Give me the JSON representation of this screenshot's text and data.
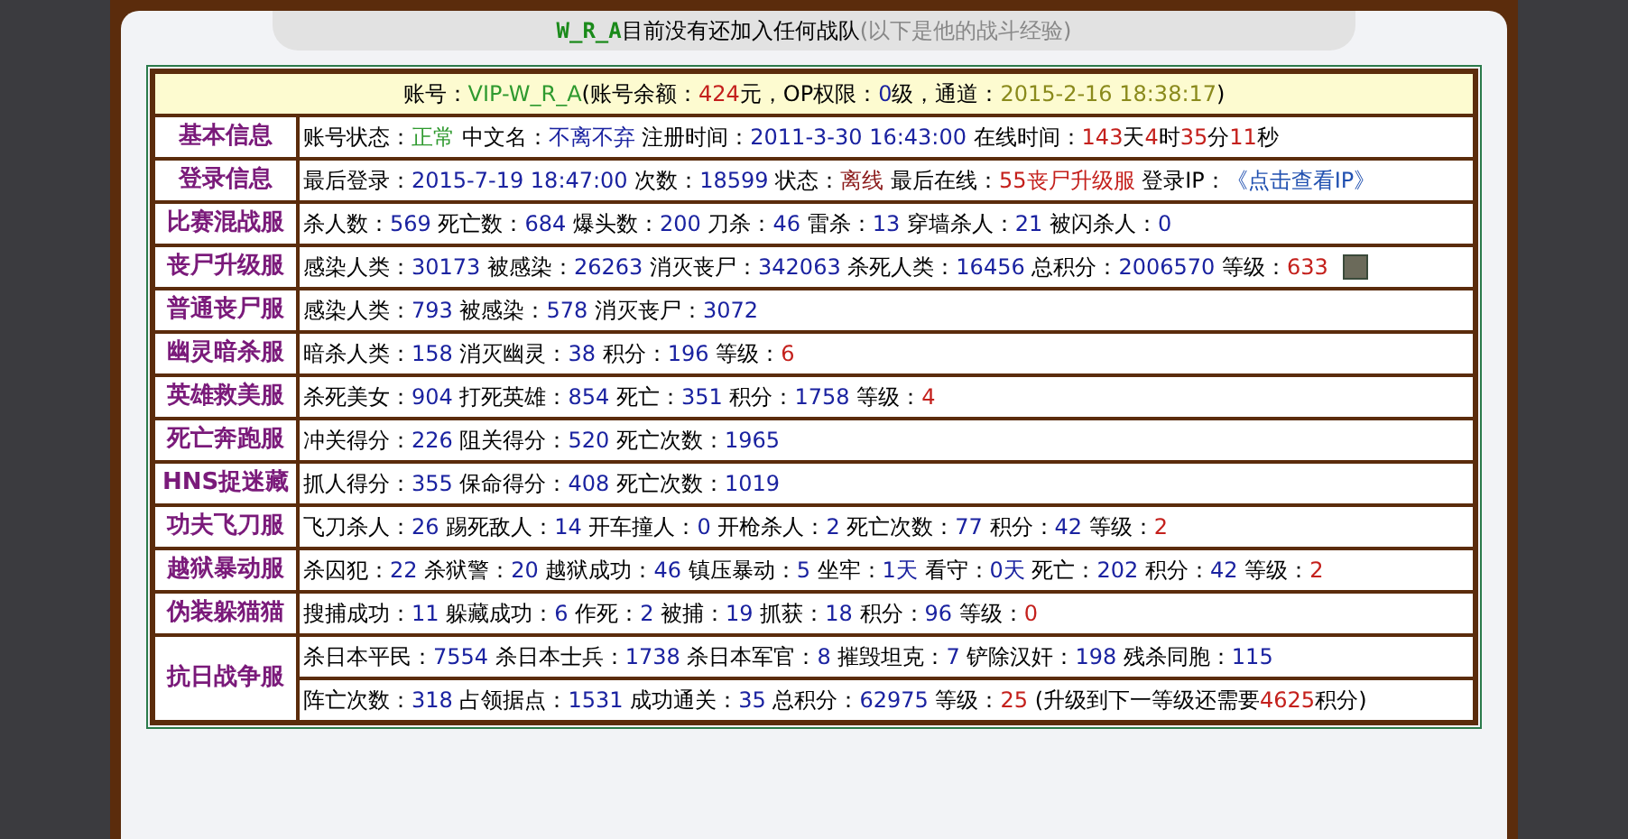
{
  "title": {
    "player": "W_R_A",
    "text": "目前没有还加入任何战队",
    "note": "(以下是他的战斗经验)"
  },
  "account": [
    {
      "text": "账号：",
      "color": "#000000"
    },
    {
      "text": "VIP-W_R_A",
      "color": "#2f9a2f"
    },
    {
      "text": "(账号余额：",
      "color": "#000000"
    },
    {
      "text": "424",
      "color": "#c4201c"
    },
    {
      "text": "元，OP权限：",
      "color": "#000000"
    },
    {
      "text": "0",
      "color": "#1a22a0"
    },
    {
      "text": "级，通道：",
      "color": "#000000"
    },
    {
      "text": "2015-2-16 18:38:17",
      "color": "#8a8a1c"
    },
    {
      "text": ")",
      "color": "#000000"
    }
  ],
  "sections": [
    {
      "name": "基本信息",
      "lines": [
        {
          "parts": [
            {
              "text": "账号状态：",
              "color": "#000000"
            },
            {
              "text": "正常",
              "color": "#2f9a2f"
            },
            {
              "text": " 中文名：",
              "color": "#000000"
            },
            {
              "text": "不离不弃",
              "color": "#1a22a0"
            },
            {
              "text": " 注册时间：",
              "color": "#000000"
            },
            {
              "text": "2011-3-30 16:43:00",
              "color": "#1a22a0"
            },
            {
              "text": " 在线时间：",
              "color": "#000000"
            },
            {
              "text": "143",
              "color": "#c4201c"
            },
            {
              "text": "天",
              "color": "#000000"
            },
            {
              "text": "4",
              "color": "#c4201c"
            },
            {
              "text": "时",
              "color": "#000000"
            },
            {
              "text": "35",
              "color": "#c4201c"
            },
            {
              "text": "分",
              "color": "#000000"
            },
            {
              "text": "11",
              "color": "#c4201c"
            },
            {
              "text": "秒",
              "color": "#000000"
            }
          ]
        }
      ]
    },
    {
      "name": "登录信息",
      "lines": [
        {
          "parts": [
            {
              "text": "最后登录：",
              "color": "#000000"
            },
            {
              "text": "2015-7-19 18:47:00",
              "color": "#1a22a0"
            },
            {
              "text": " 次数：",
              "color": "#000000"
            },
            {
              "text": "18599",
              "color": "#1a22a0"
            },
            {
              "text": " 状态：",
              "color": "#000000"
            },
            {
              "text": "离线",
              "color": "#8b1a1a"
            },
            {
              "text": " 最后在线：",
              "color": "#000000"
            },
            {
              "text": "55丧尸升级服",
              "color": "#c4201c"
            },
            {
              "text": " 登录IP：",
              "color": "#000000"
            },
            {
              "text": "《点击查看IP》",
              "color": "#2050b0"
            }
          ]
        }
      ]
    },
    {
      "name": "比赛混战服",
      "lines": [
        {
          "parts": [
            {
              "text": "杀人数：",
              "color": "#000000"
            },
            {
              "text": "569",
              "color": "#1a22a0"
            },
            {
              "text": " 死亡数：",
              "color": "#000000"
            },
            {
              "text": "684",
              "color": "#1a22a0"
            },
            {
              "text": " 爆头数：",
              "color": "#000000"
            },
            {
              "text": "200",
              "color": "#1a22a0"
            },
            {
              "text": " 刀杀：",
              "color": "#000000"
            },
            {
              "text": "46",
              "color": "#1a22a0"
            },
            {
              "text": " 雷杀：",
              "color": "#000000"
            },
            {
              "text": "13",
              "color": "#1a22a0"
            },
            {
              "text": " 穿墙杀人：",
              "color": "#000000"
            },
            {
              "text": "21",
              "color": "#1a22a0"
            },
            {
              "text": " 被闪杀人：",
              "color": "#000000"
            },
            {
              "text": "0",
              "color": "#1a22a0"
            }
          ]
        }
      ]
    },
    {
      "name": "丧尸升级服",
      "lines": [
        {
          "avatar": true,
          "parts": [
            {
              "text": "感染人类：",
              "color": "#000000"
            },
            {
              "text": "30173",
              "color": "#1a22a0"
            },
            {
              "text": " 被感染：",
              "color": "#000000"
            },
            {
              "text": "26263",
              "color": "#1a22a0"
            },
            {
              "text": " 消灭丧尸：",
              "color": "#000000"
            },
            {
              "text": "342063",
              "color": "#1a22a0"
            },
            {
              "text": " 杀死人类：",
              "color": "#000000"
            },
            {
              "text": "16456",
              "color": "#1a22a0"
            },
            {
              "text": " 总积分：",
              "color": "#000000"
            },
            {
              "text": "2006570",
              "color": "#1a22a0"
            },
            {
              "text": " 等级：",
              "color": "#000000"
            },
            {
              "text": "633",
              "color": "#c4201c"
            }
          ]
        }
      ]
    },
    {
      "name": "普通丧尸服",
      "lines": [
        {
          "parts": [
            {
              "text": "感染人类：",
              "color": "#000000"
            },
            {
              "text": "793",
              "color": "#1a22a0"
            },
            {
              "text": " 被感染：",
              "color": "#000000"
            },
            {
              "text": "578",
              "color": "#1a22a0"
            },
            {
              "text": " 消灭丧尸：",
              "color": "#000000"
            },
            {
              "text": "3072",
              "color": "#1a22a0"
            }
          ]
        }
      ]
    },
    {
      "name": "幽灵暗杀服",
      "lines": [
        {
          "parts": [
            {
              "text": "暗杀人类：",
              "color": "#000000"
            },
            {
              "text": "158",
              "color": "#1a22a0"
            },
            {
              "text": " 消灭幽灵：",
              "color": "#000000"
            },
            {
              "text": "38",
              "color": "#1a22a0"
            },
            {
              "text": " 积分：",
              "color": "#000000"
            },
            {
              "text": "196",
              "color": "#1a22a0"
            },
            {
              "text": " 等级：",
              "color": "#000000"
            },
            {
              "text": "6",
              "color": "#c4201c"
            }
          ]
        }
      ]
    },
    {
      "name": "英雄救美服",
      "lines": [
        {
          "parts": [
            {
              "text": "杀死美女：",
              "color": "#000000"
            },
            {
              "text": "904",
              "color": "#1a22a0"
            },
            {
              "text": " 打死英雄：",
              "color": "#000000"
            },
            {
              "text": "854",
              "color": "#1a22a0"
            },
            {
              "text": " 死亡：",
              "color": "#000000"
            },
            {
              "text": "351",
              "color": "#1a22a0"
            },
            {
              "text": " 积分：",
              "color": "#000000"
            },
            {
              "text": "1758",
              "color": "#1a22a0"
            },
            {
              "text": " 等级：",
              "color": "#000000"
            },
            {
              "text": "4",
              "color": "#c4201c"
            }
          ]
        }
      ]
    },
    {
      "name": "死亡奔跑服",
      "lines": [
        {
          "parts": [
            {
              "text": "冲关得分：",
              "color": "#000000"
            },
            {
              "text": "226",
              "color": "#1a22a0"
            },
            {
              "text": " 阻关得分：",
              "color": "#000000"
            },
            {
              "text": "520",
              "color": "#1a22a0"
            },
            {
              "text": " 死亡次数：",
              "color": "#000000"
            },
            {
              "text": "1965",
              "color": "#1a22a0"
            }
          ]
        }
      ]
    },
    {
      "name": "HNS捉迷藏",
      "lines": [
        {
          "parts": [
            {
              "text": "抓人得分：",
              "color": "#000000"
            },
            {
              "text": "355",
              "color": "#1a22a0"
            },
            {
              "text": " 保命得分：",
              "color": "#000000"
            },
            {
              "text": "408",
              "color": "#1a22a0"
            },
            {
              "text": " 死亡次数：",
              "color": "#000000"
            },
            {
              "text": "1019",
              "color": "#1a22a0"
            }
          ]
        }
      ]
    },
    {
      "name": "功夫飞刀服",
      "lines": [
        {
          "parts": [
            {
              "text": "飞刀杀人：",
              "color": "#000000"
            },
            {
              "text": "26",
              "color": "#1a22a0"
            },
            {
              "text": " 踢死敌人：",
              "color": "#000000"
            },
            {
              "text": "14",
              "color": "#1a22a0"
            },
            {
              "text": " 开车撞人：",
              "color": "#000000"
            },
            {
              "text": "0",
              "color": "#1a22a0"
            },
            {
              "text": " 开枪杀人：",
              "color": "#000000"
            },
            {
              "text": "2",
              "color": "#1a22a0"
            },
            {
              "text": " 死亡次数：",
              "color": "#000000"
            },
            {
              "text": "77",
              "color": "#1a22a0"
            },
            {
              "text": " 积分：",
              "color": "#000000"
            },
            {
              "text": "42",
              "color": "#1a22a0"
            },
            {
              "text": " 等级：",
              "color": "#000000"
            },
            {
              "text": "2",
              "color": "#c4201c"
            }
          ]
        }
      ]
    },
    {
      "name": "越狱暴动服",
      "lines": [
        {
          "parts": [
            {
              "text": "杀囚犯：",
              "color": "#000000"
            },
            {
              "text": "22",
              "color": "#1a22a0"
            },
            {
              "text": " 杀狱警：",
              "color": "#000000"
            },
            {
              "text": "20",
              "color": "#1a22a0"
            },
            {
              "text": " 越狱成功：",
              "color": "#000000"
            },
            {
              "text": "46",
              "color": "#1a22a0"
            },
            {
              "text": " 镇压暴动：",
              "color": "#000000"
            },
            {
              "text": "5",
              "color": "#1a22a0"
            },
            {
              "text": " 坐牢：",
              "color": "#000000"
            },
            {
              "text": "1天",
              "color": "#1a22a0"
            },
            {
              "text": " 看守：",
              "color": "#000000"
            },
            {
              "text": "0天",
              "color": "#1a22a0"
            },
            {
              "text": " 死亡：",
              "color": "#000000"
            },
            {
              "text": "202",
              "color": "#1a22a0"
            },
            {
              "text": " 积分：",
              "color": "#000000"
            },
            {
              "text": "42",
              "color": "#1a22a0"
            },
            {
              "text": " 等级：",
              "color": "#000000"
            },
            {
              "text": "2",
              "color": "#c4201c"
            }
          ]
        }
      ]
    },
    {
      "name": "伪装躲猫猫",
      "lines": [
        {
          "parts": [
            {
              "text": "搜捕成功：",
              "color": "#000000"
            },
            {
              "text": "11",
              "color": "#1a22a0"
            },
            {
              "text": " 躲藏成功：",
              "color": "#000000"
            },
            {
              "text": "6",
              "color": "#1a22a0"
            },
            {
              "text": " 作死：",
              "color": "#000000"
            },
            {
              "text": "2",
              "color": "#1a22a0"
            },
            {
              "text": " 被捕：",
              "color": "#000000"
            },
            {
              "text": "19",
              "color": "#1a22a0"
            },
            {
              "text": " 抓获：",
              "color": "#000000"
            },
            {
              "text": "18",
              "color": "#1a22a0"
            },
            {
              "text": " 积分：",
              "color": "#000000"
            },
            {
              "text": "96",
              "color": "#1a22a0"
            },
            {
              "text": " 等级：",
              "color": "#000000"
            },
            {
              "text": "0",
              "color": "#c4201c"
            }
          ]
        }
      ]
    },
    {
      "name": "抗日战争服",
      "lines": [
        {
          "parts": [
            {
              "text": "杀日本平民：",
              "color": "#000000"
            },
            {
              "text": "7554",
              "color": "#1a22a0"
            },
            {
              "text": " 杀日本士兵：",
              "color": "#000000"
            },
            {
              "text": "1738",
              "color": "#1a22a0"
            },
            {
              "text": " 杀日本军官：",
              "color": "#000000"
            },
            {
              "text": "8",
              "color": "#1a22a0"
            },
            {
              "text": " 摧毁坦克：",
              "color": "#000000"
            },
            {
              "text": "7",
              "color": "#1a22a0"
            },
            {
              "text": " 铲除汉奸：",
              "color": "#000000"
            },
            {
              "text": "198",
              "color": "#1a22a0"
            },
            {
              "text": " 残杀同胞：",
              "color": "#000000"
            },
            {
              "text": "115",
              "color": "#1a22a0"
            }
          ]
        },
        {
          "parts": [
            {
              "text": "阵亡次数：",
              "color": "#000000"
            },
            {
              "text": "318",
              "color": "#1a22a0"
            },
            {
              "text": " 占领据点：",
              "color": "#000000"
            },
            {
              "text": "1531",
              "color": "#1a22a0"
            },
            {
              "text": " 成功通关：",
              "color": "#000000"
            },
            {
              "text": "35",
              "color": "#1a22a0"
            },
            {
              "text": " 总积分：",
              "color": "#000000"
            },
            {
              "text": "62975",
              "color": "#1a22a0"
            },
            {
              "text": " 等级：",
              "color": "#000000"
            },
            {
              "text": "25",
              "color": "#c4201c"
            },
            {
              "text": " (升级到下一等级还需要",
              "color": "#000000"
            },
            {
              "text": "4625",
              "color": "#c4201c"
            },
            {
              "text": "积分)",
              "color": "#000000"
            }
          ]
        }
      ]
    }
  ]
}
